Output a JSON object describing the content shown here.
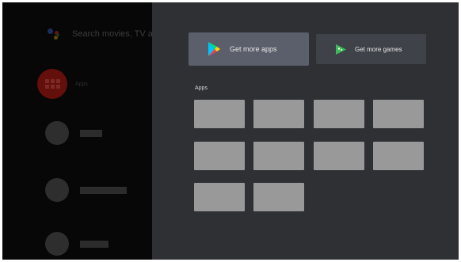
{
  "sidebar": {
    "search_placeholder": "Search movies, TV and more",
    "apps_label": "Apps",
    "colors": {
      "apps_circle": "#630f0b",
      "assistant_blue": "#3b5bd9",
      "assistant_red": "#d23a2b",
      "assistant_yellow": "#e3b21c",
      "assistant_green": "#2c9a48"
    },
    "icons": {
      "search": "google-assistant-icon",
      "apps": "apps-grid-icon"
    }
  },
  "panel": {
    "buttons": [
      {
        "label": "Get more apps",
        "icon": "google-play-store-icon",
        "focused": true
      },
      {
        "label": "Get more games",
        "icon": "google-play-games-icon",
        "focused": false
      }
    ],
    "section_title": "Apps",
    "tile_color": "#999999"
  }
}
